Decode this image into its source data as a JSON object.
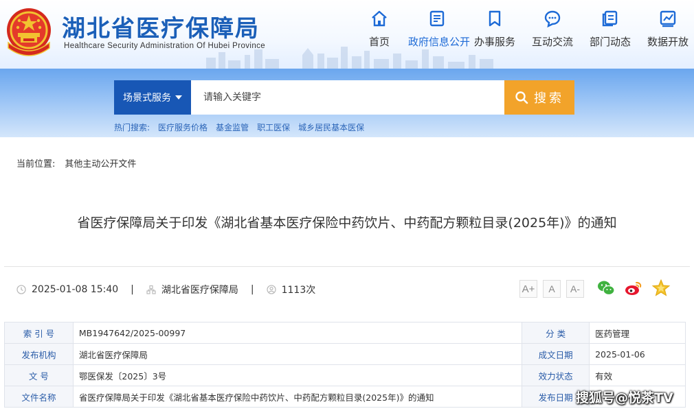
{
  "header": {
    "title": "湖北省医疗保障局",
    "subtitle": "Healthcare Security Administration Of Hubei Province",
    "emblem_icon": "national-emblem-icon"
  },
  "nav": {
    "items": [
      {
        "label": "首页",
        "icon": "home-icon"
      },
      {
        "label": "政府信息公开",
        "icon": "document-icon"
      },
      {
        "label": "办事服务",
        "icon": "bookmark-icon"
      },
      {
        "label": "互动交流",
        "icon": "chat-icon"
      },
      {
        "label": "部门动态",
        "icon": "news-icon"
      },
      {
        "label": "数据开放",
        "icon": "chart-icon"
      }
    ]
  },
  "search": {
    "scope_label": "场景式服务",
    "placeholder": "请输入关键字",
    "button_label": "搜索",
    "hot_label": "热门搜索:",
    "hot_terms": [
      "医疗服务价格",
      "基金监管",
      "职工医保",
      "城乡居民基本医保"
    ]
  },
  "breadcrumb": {
    "label": "当前位置:",
    "current": "其他主动公开文件"
  },
  "article": {
    "title": "省医疗保障局关于印发《湖北省基本医疗保险中药饮片、中药配方颗粒目录(2025年)》的通知",
    "datetime": "2025-01-08 15:40",
    "source": "湖北省医疗保障局",
    "views": "1113次",
    "separator": "|"
  },
  "font_sizes": [
    "A+",
    "A",
    "A-"
  ],
  "share_icons": [
    "wechat-icon",
    "weibo-icon",
    "favorite-star-icon"
  ],
  "info_table": {
    "rows": [
      {
        "k1": "索 引 号",
        "v1": "MB1947642/2025-00997",
        "k2": "分 类",
        "v2": "医药管理"
      },
      {
        "k1": "发布机构",
        "v1": "湖北省医疗保障局",
        "k2": "成文日期",
        "v2": "2025-01-06"
      },
      {
        "k1": "文 号",
        "v1": "鄂医保发〔2025〕3号",
        "k2": "效力状态",
        "v2": "有效"
      },
      {
        "k1": "文件名称",
        "v1": "省医疗保障局关于印发《湖北省基本医疗保险中药饮片、中药配方颗粒目录(2025年)》的通知",
        "k2": "发布日期",
        "v2": ""
      }
    ]
  },
  "watermark": "搜狐号@悦茶TV",
  "colors": {
    "brand_blue": "#1b5fb8",
    "scope_blue": "#1857b5",
    "search_orange": "#f2a32a",
    "link_blue": "#2b65b8"
  }
}
